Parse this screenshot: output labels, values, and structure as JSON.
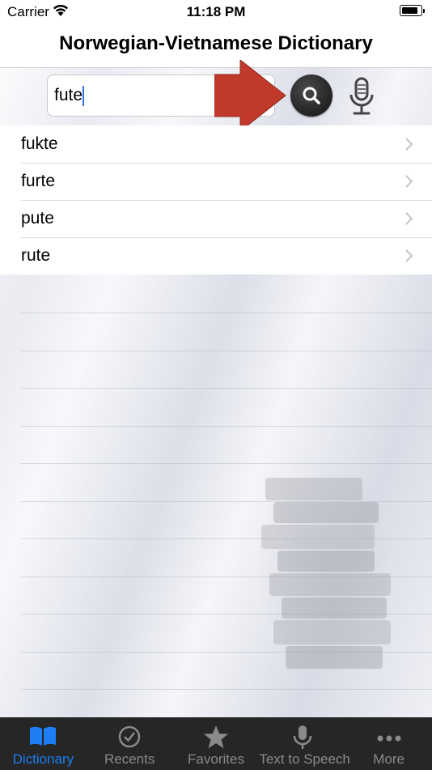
{
  "status_bar": {
    "carrier": "Carrier",
    "time": "11:18 PM",
    "battery_level": 0.9
  },
  "header": {
    "title": "Norwegian-Vietnamese Dictionary"
  },
  "search": {
    "query": "fute",
    "placeholder": ""
  },
  "results": [
    {
      "label": "fukte"
    },
    {
      "label": "furte"
    },
    {
      "label": "pute"
    },
    {
      "label": "rute"
    }
  ],
  "tab_bar": {
    "active": "Dictionary",
    "tabs": [
      {
        "label": "Dictionary",
        "icon": "book-icon"
      },
      {
        "label": "Recents",
        "icon": "clock-check-icon"
      },
      {
        "label": "Favorites",
        "icon": "star-icon"
      },
      {
        "label": "Text to Speech",
        "icon": "microphone-icon"
      },
      {
        "label": "More",
        "icon": "more-dots-icon"
      }
    ]
  },
  "colors": {
    "accent": "#1c7ef2",
    "arrow": "#c0392b",
    "tab_bar_bg": "#262626"
  }
}
